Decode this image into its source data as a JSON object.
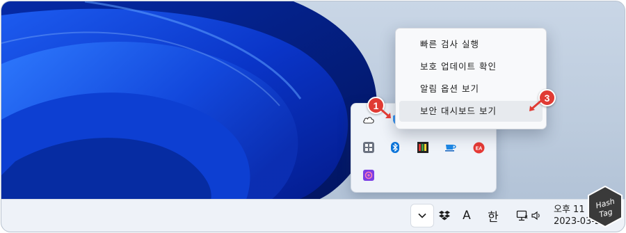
{
  "context_menu": {
    "items": [
      {
        "label": "빠른 검사 실행"
      },
      {
        "label": "보호 업데이트 확인"
      },
      {
        "label": "알림 옵션 보기"
      },
      {
        "label": "보안 대시보드 보기"
      }
    ],
    "highlighted_index": 3
  },
  "tray_flyout": {
    "icons": [
      {
        "name": "onedrive-cloud-icon"
      },
      {
        "name": "windows-security-shield-icon"
      },
      {
        "name": "app-grid-icon"
      },
      {
        "name": "bluetooth-icon"
      },
      {
        "name": "color-palette-app-icon"
      },
      {
        "name": "coffee-cup-icon"
      },
      {
        "name": "ea-app-icon"
      },
      {
        "name": "purple-app-icon"
      }
    ]
  },
  "taskbar": {
    "items": [
      {
        "name": "show-hidden-icons-chevron",
        "glyph": "⌄"
      },
      {
        "name": "dropbox-icon"
      },
      {
        "name": "input-mode-english",
        "label": "A"
      },
      {
        "name": "input-mode-korean",
        "label": "한"
      },
      {
        "name": "network-icon"
      },
      {
        "name": "speaker-icon"
      }
    ],
    "clock": {
      "time": "오후 11",
      "date": "2023-03-27"
    }
  },
  "annotations": {
    "step_a": "1",
    "step_b": "3"
  },
  "watermark": {
    "line1": "Hash",
    "line2": "Tag"
  },
  "colors": {
    "badge": "#e03b34",
    "wallpaper_blue": "#0b3fd6",
    "taskbar": "#eef2f8",
    "menu_hover": "#e7eaee"
  }
}
